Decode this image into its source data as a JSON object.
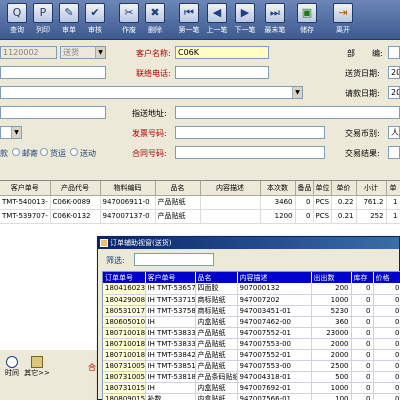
{
  "toolbar": {
    "items": [
      {
        "label": "查询",
        "icon": "query-icon"
      },
      {
        "label": "列印",
        "icon": "print-icon"
      },
      {
        "label": "审单",
        "icon": "review-icon"
      },
      {
        "label": "审核",
        "icon": "audit-icon"
      },
      {
        "label": "作废",
        "icon": "void-icon"
      },
      {
        "label": "删除",
        "icon": "delete-icon"
      },
      {
        "label": "第一笔",
        "icon": "first-record-icon"
      },
      {
        "label": "上一笔",
        "icon": "prev-record-icon"
      },
      {
        "label": "下一笔",
        "icon": "next-record-icon"
      },
      {
        "label": "最末笔",
        "icon": "last-record-icon"
      },
      {
        "label": "储存",
        "icon": "save-icon"
      },
      {
        "label": "离开",
        "icon": "exit-icon"
      }
    ]
  },
  "form": {
    "order_no": "1120002",
    "order_type": "送货",
    "customer_name_label": "客户名称:",
    "customer_name_value": "C06K",
    "contact_phone_label": "联络电话:",
    "delivery_address_label": "指送地址:",
    "invoice_no_label": "发票号码:",
    "contract_no_label": "合同号码:",
    "dept_label": "部",
    "code_label": "编:",
    "delivery_date_label": "送货日期:",
    "delivery_date_value": "20",
    "request_date_label": "请款日期:",
    "request_date_value": "20",
    "currency_label": "交易币别:",
    "currency_value": "人",
    "settle_label": "交易结果:",
    "options": [
      "款",
      "邮寄",
      "货运",
      "送动"
    ]
  },
  "main_grid": {
    "headers": [
      "客户单号",
      "产品代号",
      "物料编码",
      "品名",
      "内容描述",
      "本次数",
      "备品",
      "单位",
      "单价",
      "小计",
      "单"
    ],
    "rows": [
      [
        "TMT-540013-",
        "C06K-0089",
        "947006911-0",
        "产品贴纸",
        "",
        "3460",
        "0",
        "PCS",
        "0.22",
        "761.2",
        "1"
      ],
      [
        "TMT-539707-",
        "C06K-0132",
        "947007137-0",
        "产品贴纸",
        "",
        "1200",
        "0",
        "PCS",
        "0.21",
        "252",
        "1"
      ]
    ]
  },
  "bottom": {
    "btn1_label": "时间",
    "btn2_label": "其它>>",
    "side_label": "合"
  },
  "popup": {
    "title": "订单辅助视窗(送货)",
    "filter_label": "筛选:",
    "filter_value": "",
    "headers": [
      "订单单号",
      "客户单号",
      "品名",
      "内容描述",
      "出出数",
      "库存",
      "价格"
    ],
    "rows": [
      [
        "180416023",
        "IH TMT-53657",
        "四面胶",
        "907000132",
        "200",
        "0",
        "0"
      ],
      [
        "180429008",
        "IH TMT-53715",
        "商标贴纸",
        "947007202",
        "1000",
        "0",
        "0"
      ],
      [
        "180531017",
        "IH TMT-53758",
        "商标贴纸",
        "947003451-01",
        "5230",
        "0",
        "0"
      ],
      [
        "180605010",
        "IH",
        "内盒贴纸",
        "947007462-00",
        "360",
        "0",
        "0"
      ],
      [
        "180710018",
        "IH TMT-53833",
        "产品贴纸",
        "947007552-01",
        "23000",
        "0",
        "0"
      ],
      [
        "180710018",
        "IH TMT-53833",
        "产品贴纸",
        "947007553-00",
        "2000",
        "0",
        "0"
      ],
      [
        "180710018",
        "IH TMT-53842",
        "产品贴纸",
        "947007552-01",
        "2000",
        "0",
        "0"
      ],
      [
        "180731005",
        "IH TMT-53851",
        "产品贴纸",
        "947007553-00",
        "2500",
        "0",
        "0"
      ],
      [
        "180731005",
        "IH TMT-53818",
        "产品条码贴纸",
        "947004318-01",
        "500",
        "0",
        "0"
      ],
      [
        "180731015",
        "IH",
        "内盒贴纸",
        "947007692-01",
        "1000",
        "0",
        "0"
      ],
      [
        "180809015",
        "补数",
        "内盒贴纸",
        "947007566-01",
        "100",
        "0",
        "0"
      ],
      [
        "180910004",
        "IH TMT-53904",
        "产品贴纸",
        "947007041-01",
        "200",
        "0",
        "0"
      ]
    ]
  },
  "colors": {
    "toolbar_bg": "#3f5a8f",
    "form_bg": "#ece9d8",
    "label_red": "#b00000",
    "popup_header": "#0000c8"
  }
}
